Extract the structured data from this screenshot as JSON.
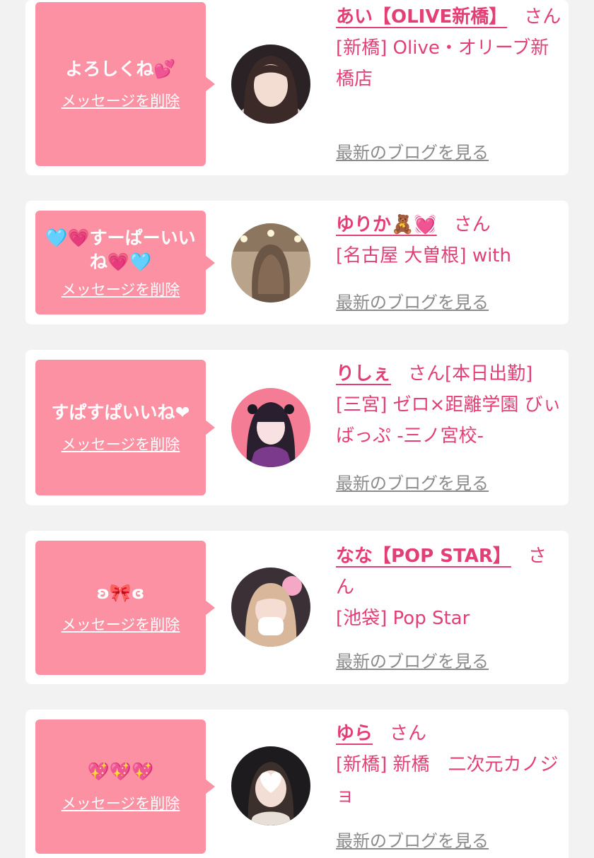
{
  "delete_label": "メッセージを削除",
  "blog_label": "最新のブログを見る",
  "honorific": "さん",
  "colors": {
    "bubble": "#fb91a3",
    "accent": "#e43f74",
    "link_gray": "#8b8b8b",
    "background": "#f2f2f2"
  },
  "messages": [
    {
      "message": "よろしくね💕",
      "name": "あい【OLIVE新橋】",
      "suffix": "",
      "shop": "[新橋] Olive・オリーブ新橋店"
    },
    {
      "message": "🩵💗すーぱーいいね💗🩵",
      "name": "ゆりか🧸💓",
      "suffix": "",
      "shop": "[名古屋 大曽根] with"
    },
    {
      "message": "すぱすぱいいね❤",
      "name": "りしぇ",
      "suffix": "[本日出勤]",
      "shop": "[三宮] ゼロ×距離学園 びぃばっぷ -三ノ宮校-"
    },
    {
      "message": "ʚ🎀ɞ",
      "name": "なな【POP STAR】",
      "suffix": "",
      "shop": "[池袋] Pop Star"
    },
    {
      "message": "💖💖💖",
      "name": "ゆら",
      "suffix": "",
      "shop": "[新橋] 新橋　二次元カノジョ"
    }
  ]
}
